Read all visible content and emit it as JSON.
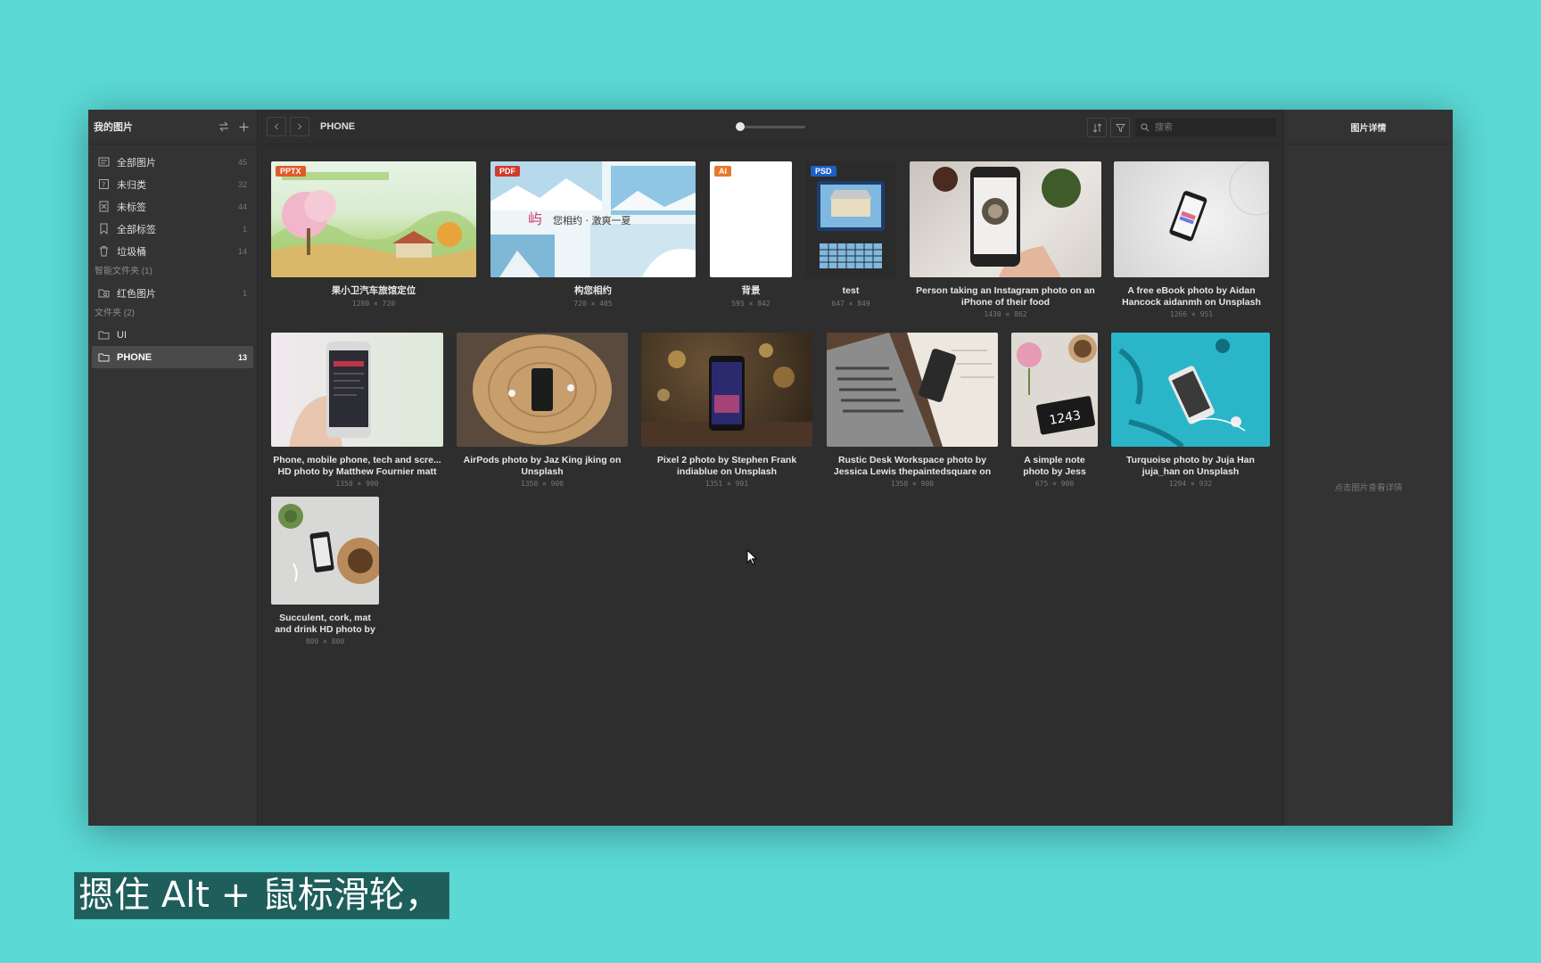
{
  "sidebar": {
    "title": "我的图片",
    "items": [
      {
        "label": "全部图片",
        "count": "45",
        "icon": "gallery-icon"
      },
      {
        "label": "未归类",
        "count": "32",
        "icon": "unsorted-icon"
      },
      {
        "label": "未标签",
        "count": "44",
        "icon": "untagged-icon"
      },
      {
        "label": "全部标签",
        "count": "1",
        "icon": "tag-icon"
      },
      {
        "label": "垃圾桶",
        "count": "14",
        "icon": "trash-icon"
      }
    ],
    "smart_section": "智能文件夹 (1)",
    "smart_items": [
      {
        "label": "红色图片",
        "count": "1",
        "icon": "smart-folder-icon"
      }
    ],
    "folder_section": "文件夹 (2)",
    "folders": [
      {
        "label": "UI",
        "count": "",
        "icon": "folder-icon"
      },
      {
        "label": "PHONE",
        "count": "13",
        "icon": "folder-icon",
        "active": true
      }
    ]
  },
  "toolbar": {
    "breadcrumb": "PHONE",
    "zoom_level": 0.04,
    "search_placeholder": "搜索"
  },
  "items": [
    {
      "caption": "果小卫汽车旅馆定位",
      "dims": "1280 × 720",
      "badge": "PPTX",
      "badge_color": "#e05a2a"
    },
    {
      "caption": "构您相约",
      "dims": "720 × 405",
      "badge": "PDF",
      "badge_color": "#d13b2b"
    },
    {
      "caption": "背景",
      "dims": "595 × 842",
      "badge": "AI",
      "badge_color": "#e8782a"
    },
    {
      "caption": "test",
      "dims": "647 × 849",
      "badge": "PSD",
      "badge_color": "#1c5fc7"
    },
    {
      "caption": "Person taking an Instagram photo on an iPhone of their food",
      "dims": "1430 × 862"
    },
    {
      "caption": "A free eBook photo by Aidan Hancock aidanmh on Unsplash",
      "dims": "1266 × 951"
    },
    {
      "caption": "Phone, mobile phone, tech and scre... HD photo by Matthew Fournier matt",
      "dims": "1350 × 900"
    },
    {
      "caption": "AirPods photo by Jaz King jking on Unsplash",
      "dims": "1350 × 900"
    },
    {
      "caption": "Pixel 2 photo by Stephen Frank indiablue on Unsplash",
      "dims": "1351 × 901"
    },
    {
      "caption": "Rustic Desk Workspace photo by Jessica Lewis thepaintedsquare on",
      "dims": "1350 × 900"
    },
    {
      "caption": "A simple note photo by Jess",
      "dims": "675 × 900"
    },
    {
      "caption": "Turquoise photo by Juja Han juja_han on Unsplash",
      "dims": "1294 × 932"
    },
    {
      "caption": "Succulent, cork, mat and drink HD photo by",
      "dims": "800 × 800"
    }
  ],
  "inspector": {
    "title": "图片详情",
    "empty_text": "点击图片查看详情"
  },
  "overlay_subtitle": "摁住 Alt + 鼠标滑轮，",
  "colors": {
    "background": "#5ad9d5",
    "panel": "#2e2e2e",
    "sidebar": "#333333"
  }
}
